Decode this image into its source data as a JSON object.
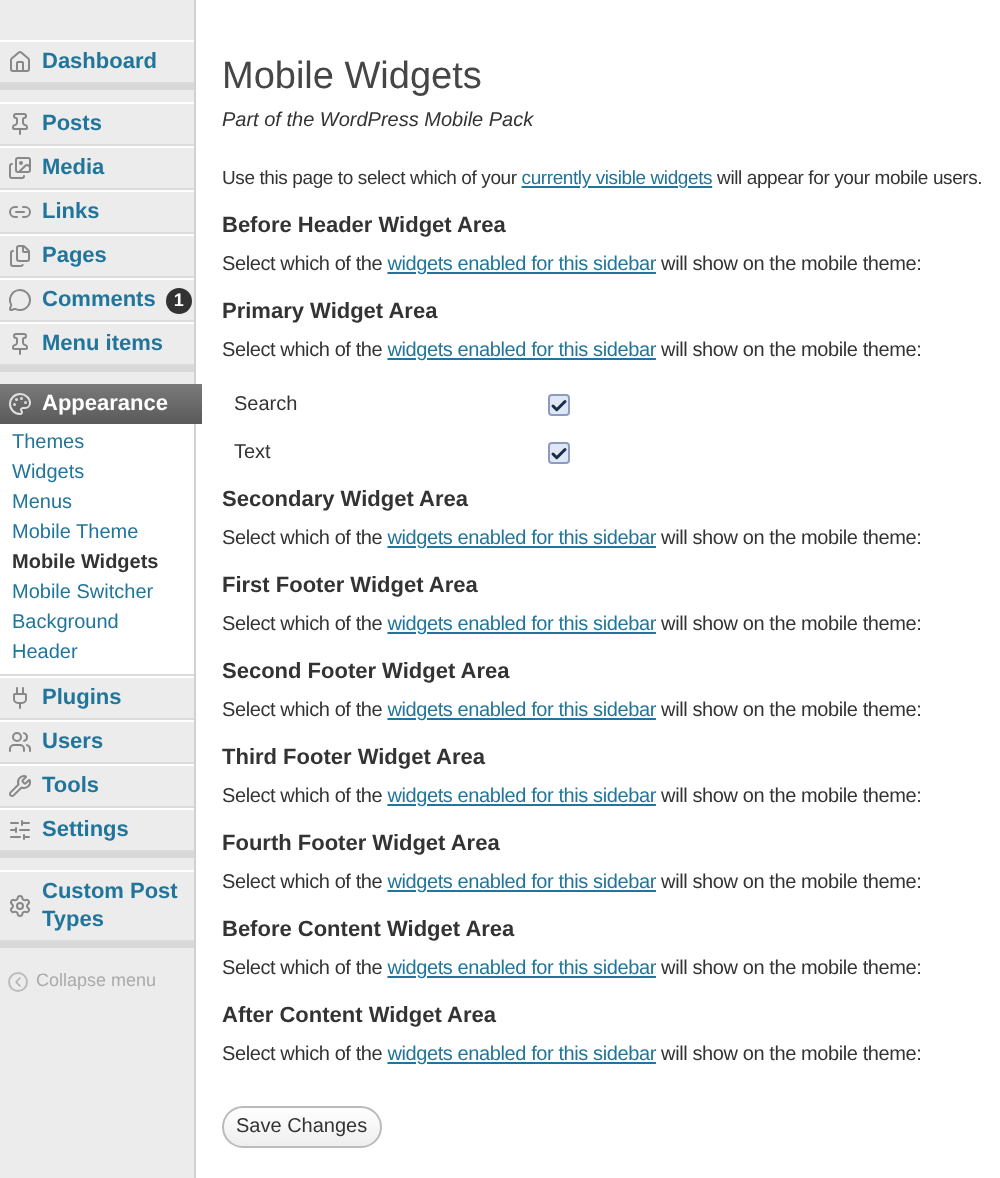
{
  "sidebar": {
    "groups": [
      [
        {
          "label": "Dashboard",
          "selected": false
        }
      ],
      [
        {
          "label": "Posts",
          "selected": false
        },
        {
          "label": "Media",
          "selected": false
        },
        {
          "label": "Links",
          "selected": false
        },
        {
          "label": "Pages",
          "selected": false
        },
        {
          "label": "Comments",
          "selected": false,
          "badge": "1"
        },
        {
          "label": "Menu items",
          "selected": false
        }
      ],
      [
        {
          "label": "Appearance",
          "selected": true,
          "children": [
            {
              "label": "Themes",
              "selected": false
            },
            {
              "label": "Widgets",
              "selected": false
            },
            {
              "label": "Menus",
              "selected": false
            },
            {
              "label": "Mobile Theme",
              "selected": false
            },
            {
              "label": "Mobile Widgets",
              "selected": true
            },
            {
              "label": "Mobile Switcher",
              "selected": false
            },
            {
              "label": "Background",
              "selected": false
            },
            {
              "label": "Header",
              "selected": false
            }
          ]
        },
        {
          "label": "Plugins",
          "selected": false
        },
        {
          "label": "Users",
          "selected": false
        },
        {
          "label": "Tools",
          "selected": false
        },
        {
          "label": "Settings",
          "selected": false
        }
      ],
      [
        {
          "label": "Custom Post Types",
          "selected": false
        }
      ]
    ],
    "collapse": "Collapse menu"
  },
  "page": {
    "title": "Mobile Widgets",
    "subtitle": "Part of the WordPress Mobile Pack",
    "intro": {
      "before": "Use this page to select which of your ",
      "link": "currently visible widgets",
      "after": " will appear for your mobile users."
    },
    "areas": [
      {
        "title": "Before Header Widget Area",
        "text": {
          "before": "Select which of the ",
          "link": "widgets enabled for this sidebar",
          "after": " will show on the mobile theme:"
        }
      },
      {
        "title": "Primary Widget Area",
        "text": {
          "before": "Select which of the ",
          "link": "widgets enabled for this sidebar",
          "after": " will show on the mobile theme:"
        },
        "widgets": [
          {
            "label": "Search",
            "checked": true
          },
          {
            "label": "Text",
            "checked": true
          }
        ]
      },
      {
        "title": "Secondary Widget Area",
        "text": {
          "before": "Select which of the ",
          "link": "widgets enabled for this sidebar",
          "after": " will show on the mobile theme:"
        }
      },
      {
        "title": "First Footer Widget Area",
        "text": {
          "before": "Select which of the ",
          "link": "widgets enabled for this sidebar",
          "after": " will show on the mobile theme:"
        }
      },
      {
        "title": "Second Footer Widget Area",
        "text": {
          "before": "Select which of the ",
          "link": "widgets enabled for this sidebar",
          "after": " will show on the mobile theme:"
        }
      },
      {
        "title": "Third Footer Widget Area",
        "text": {
          "before": "Select which of the ",
          "link": "widgets enabled for this sidebar",
          "after": " will show on the mobile theme:"
        }
      },
      {
        "title": "Fourth Footer Widget Area",
        "text": {
          "before": "Select which of the ",
          "link": "widgets enabled for this sidebar",
          "after": " will show on the mobile theme:"
        }
      },
      {
        "title": "Before Content Widget Area",
        "text": {
          "before": "Select which of the ",
          "link": "widgets enabled for this sidebar",
          "after": " will show on the mobile theme:"
        }
      },
      {
        "title": "After Content Widget Area",
        "text": {
          "before": "Select which of the ",
          "link": "widgets enabled for this sidebar",
          "after": " will show on the mobile theme:"
        }
      }
    ],
    "save": "Save Changes"
  }
}
